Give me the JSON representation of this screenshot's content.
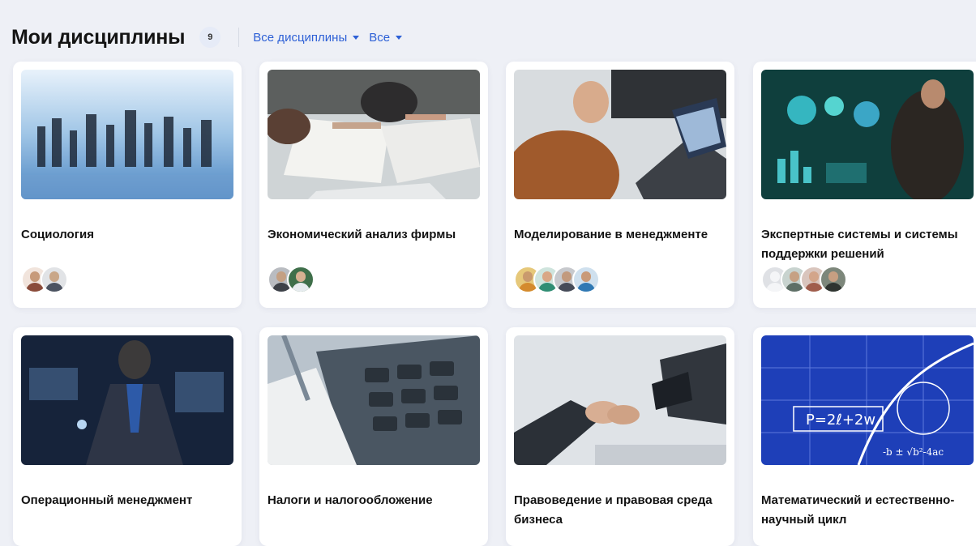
{
  "header": {
    "title": "Мои дисциплины",
    "count": "9",
    "filter_all": "Все дисциплины",
    "filter_status": "Все"
  },
  "courses": [
    {
      "title": "Социология",
      "avatars": [
        "#c79a7a",
        "#7d8590"
      ]
    },
    {
      "title": "Экономический анализ фирмы",
      "avatars": [
        "#6b6f76",
        "#3f6f4a"
      ]
    },
    {
      "title": "Моделирование в менеджменте",
      "avatars": [
        "#d39a4d",
        "#3d8a74",
        "#5a6170",
        "#3b7fb5"
      ]
    },
    {
      "title": "Экспертные системы и системы поддержки решений",
      "avatars": [
        "#d5d7dc",
        "#6b7d6a",
        "#b9776a",
        "#4e5a50"
      ]
    },
    {
      "title": "Операционный менеджмент",
      "avatars": []
    },
    {
      "title": "Налоги и налогообложение",
      "avatars": []
    },
    {
      "title": "Правоведение и правовая среда бизнеса",
      "avatars": []
    },
    {
      "title": "Математический и естественно-научный цикл",
      "avatars": []
    }
  ]
}
